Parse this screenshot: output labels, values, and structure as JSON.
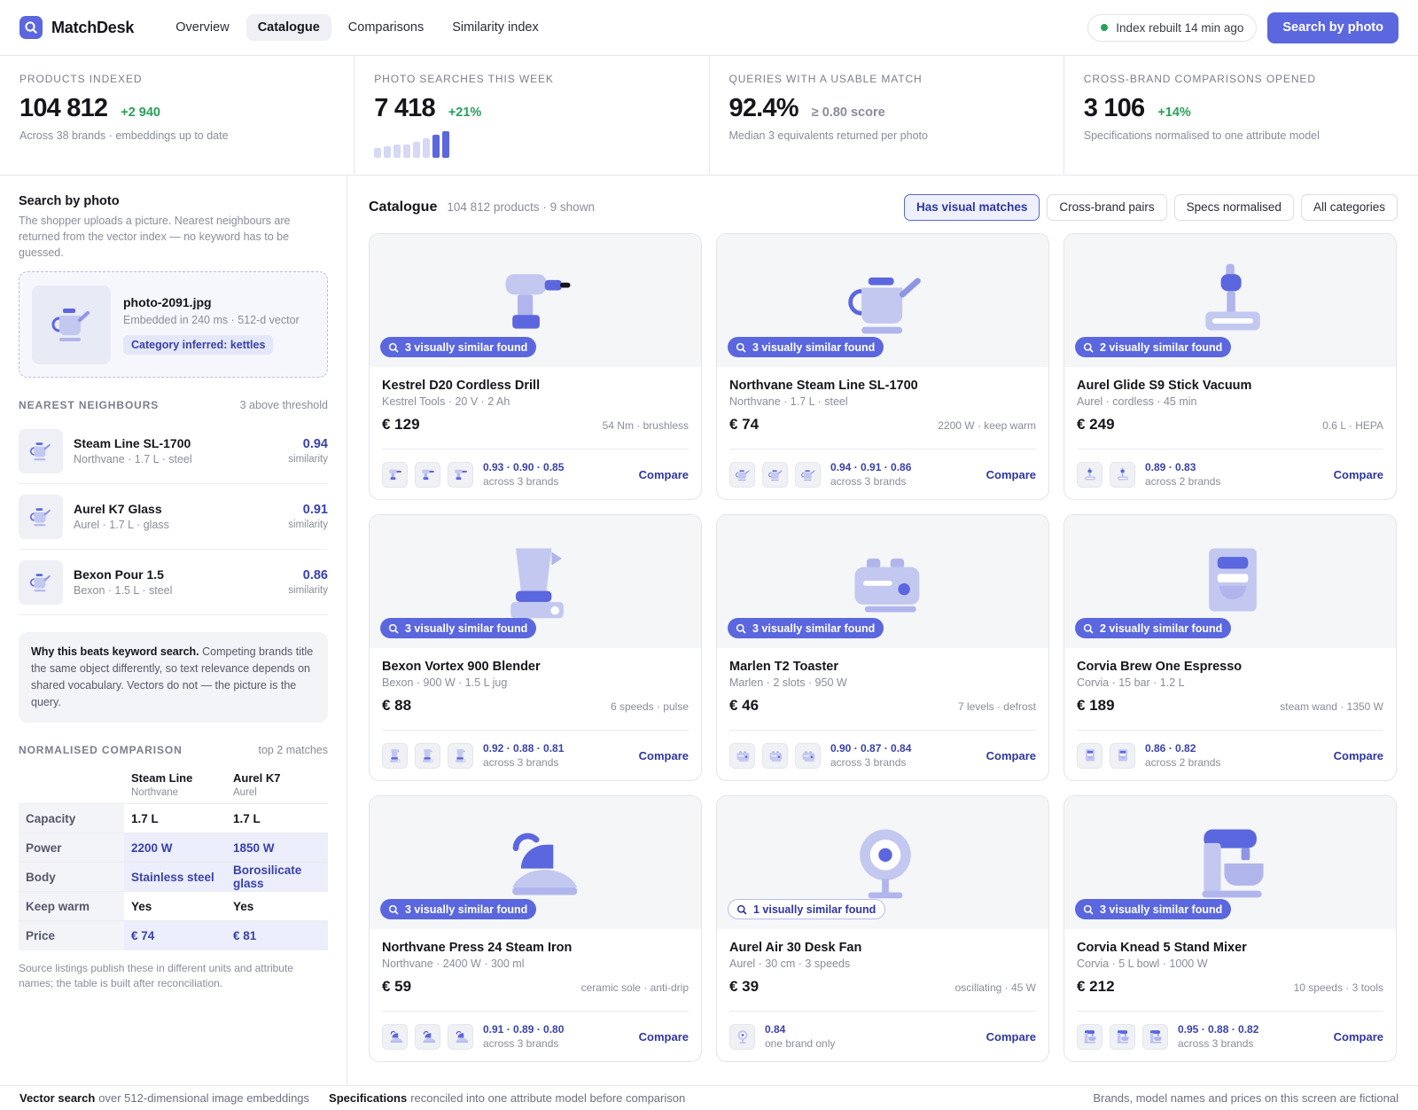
{
  "app": {
    "name": "MatchDesk",
    "nav": [
      "Overview",
      "Catalogue",
      "Comparisons",
      "Similarity index"
    ],
    "active_nav": "Catalogue",
    "index_status": "Index rebuilt 14 min ago",
    "search_button": "Search by photo"
  },
  "colors": {
    "accent": "#5b67de",
    "positive": "#27a05a",
    "accent_dark": "#3942a8"
  },
  "stats": [
    {
      "label": "PRODUCTS INDEXED",
      "value": "104 812",
      "delta": "+2 940",
      "sub": "Across 38 brands · embeddings up to date"
    },
    {
      "label": "PHOTO SEARCHES THIS WEEK",
      "value": "7 418",
      "delta": "+21%",
      "sub": "",
      "sparkline": [
        0.35,
        0.42,
        0.5,
        0.5,
        0.6,
        0.72,
        0.88,
        1.0
      ]
    },
    {
      "label": "QUERIES WITH A USABLE MATCH",
      "value": "92.4%",
      "delta": "≥ 0.80 score",
      "sub": "Median 3 equivalents returned per photo"
    },
    {
      "label": "CROSS-BRAND COMPARISONS OPENED",
      "value": "3 106",
      "delta": "+14%",
      "sub": "Specifications normalised to one attribute model"
    }
  ],
  "search_panel": {
    "title": "Search by photo",
    "description": "The shopper uploads a picture. Nearest neighbours are returned from the vector index — no keyword has to be guessed.",
    "upload": {
      "filename": "photo-2091.jpg",
      "meta": "Embedded in 240 ms · 512-d vector",
      "tag": "Category inferred: kettles",
      "icon": "kettle-icon"
    },
    "neighbours_label": "NEAREST NEIGHBOURS",
    "neighbours_note": "3 above threshold",
    "similarity_word": "similarity",
    "neighbours": [
      {
        "name": "Steam Line SL-1700",
        "meta": "Northvane · 1.7 L · steel",
        "score": "0.94"
      },
      {
        "name": "Aurel K7 Glass",
        "meta": "Aurel · 1.7 L · glass",
        "score": "0.91"
      },
      {
        "name": "Bexon Pour 1.5",
        "meta": "Bexon · 1.5 L · steel",
        "score": "0.86"
      }
    ],
    "why_title": "Why this beats keyword search.",
    "why_text": " Competing brands title the same object differently, so text relevance depends on shared vocabulary. Vectors do not — the picture is the query.",
    "comparison_label": "NORMALISED COMPARISON",
    "comparison_note": "top 2 matches",
    "comparison": {
      "columns": [
        {
          "name": "Steam Line",
          "brand": "Northvane"
        },
        {
          "name": "Aurel K7",
          "brand": "Aurel"
        }
      ],
      "rows": [
        {
          "label": "Capacity",
          "values": [
            "1.7 L",
            "1.7 L"
          ],
          "differs": false
        },
        {
          "label": "Power",
          "values": [
            "2200 W",
            "1850 W"
          ],
          "differs": true
        },
        {
          "label": "Body",
          "values": [
            "Stainless steel",
            "Borosilicate glass"
          ],
          "differs": true
        },
        {
          "label": "Keep warm",
          "values": [
            "Yes",
            "Yes"
          ],
          "differs": false
        },
        {
          "label": "Price",
          "values": [
            "€ 74",
            "€ 81"
          ],
          "differs": true
        }
      ]
    },
    "footnote": "Source listings publish these in different units and attribute names; the table is built after reconciliation."
  },
  "catalogue": {
    "title": "Catalogue",
    "count": "104 812 products · 9 shown",
    "filters": [
      "Has visual matches",
      "Cross-brand pairs",
      "Specs normalised",
      "All categories"
    ],
    "active_filter": "Has visual matches",
    "compare_label": "Compare",
    "products": [
      {
        "name": "Kestrel D20 Cordless Drill",
        "meta": "Kestrel Tools · 20 V · 2 Ah",
        "price": "€ 129",
        "spec": "54 Nm · brushless",
        "badge": "3 visually similar found",
        "badge_style": "solid",
        "icon": "drill",
        "thumbs": 3,
        "scores": "0.93 · 0.90 · 0.85",
        "brands": "across 3 brands"
      },
      {
        "name": "Northvane Steam Line SL-1700",
        "meta": "Northvane · 1.7 L · steel",
        "price": "€ 74",
        "spec": "2200 W · keep warm",
        "badge": "3 visually similar found",
        "badge_style": "solid",
        "icon": "kettle",
        "thumbs": 3,
        "scores": "0.94 · 0.91 · 0.86",
        "brands": "across 3 brands"
      },
      {
        "name": "Aurel Glide S9 Stick Vacuum",
        "meta": "Aurel · cordless · 45 min",
        "price": "€ 249",
        "spec": "0.6 L · HEPA",
        "badge": "2 visually similar found",
        "badge_style": "solid",
        "icon": "vacuum",
        "thumbs": 2,
        "scores": "0.89 · 0.83",
        "brands": "across 2 brands"
      },
      {
        "name": "Bexon Vortex 900 Blender",
        "meta": "Bexon · 900 W · 1.5 L jug",
        "price": "€ 88",
        "spec": "6 speeds · pulse",
        "badge": "3 visually similar found",
        "badge_style": "solid",
        "icon": "blender",
        "thumbs": 3,
        "scores": "0.92 · 0.88 · 0.81",
        "brands": "across 3 brands"
      },
      {
        "name": "Marlen T2 Toaster",
        "meta": "Marlen · 2 slots · 950 W",
        "price": "€ 46",
        "spec": "7 levels · defrost",
        "badge": "3 visually similar found",
        "badge_style": "solid",
        "icon": "toaster",
        "thumbs": 3,
        "scores": "0.90 · 0.87 · 0.84",
        "brands": "across 3 brands"
      },
      {
        "name": "Corvia Brew One Espresso",
        "meta": "Corvia · 15 bar · 1.2 L",
        "price": "€ 189",
        "spec": "steam wand · 1350 W",
        "badge": "2 visually similar found",
        "badge_style": "solid",
        "icon": "espresso",
        "thumbs": 2,
        "scores": "0.86 · 0.82",
        "brands": "across 2 brands"
      },
      {
        "name": "Northvane Press 24 Steam Iron",
        "meta": "Northvane · 2400 W · 300 ml",
        "price": "€ 59",
        "spec": "ceramic sole · anti-drip",
        "badge": "3 visually similar found",
        "badge_style": "solid",
        "icon": "iron",
        "thumbs": 3,
        "scores": "0.91 · 0.89 · 0.80",
        "brands": "across 3 brands"
      },
      {
        "name": "Aurel Air 30 Desk Fan",
        "meta": "Aurel · 30 cm · 3 speeds",
        "price": "€ 39",
        "spec": "oscillating · 45 W",
        "badge": "1 visually similar found",
        "badge_style": "outline",
        "icon": "fan",
        "thumbs": 1,
        "scores": "0.84",
        "brands": "one brand only"
      },
      {
        "name": "Corvia Knead 5 Stand Mixer",
        "meta": "Corvia · 5 L bowl · 1000 W",
        "price": "€ 212",
        "spec": "10 speeds · 3 tools",
        "badge": "3 visually similar found",
        "badge_style": "solid",
        "icon": "mixer",
        "thumbs": 3,
        "scores": "0.95 · 0.88 · 0.82",
        "brands": "across 3 brands"
      }
    ]
  },
  "footer": {
    "items": [
      {
        "bold": "Vector search",
        "text": "over 512-dimensional image embeddings"
      },
      {
        "bold": "Specifications",
        "text": "reconciled into one attribute model before comparison"
      }
    ],
    "right": "Brands, model names and prices on this screen are fictional"
  }
}
